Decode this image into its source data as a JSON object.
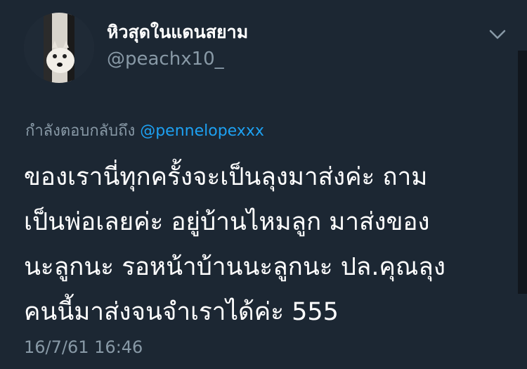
{
  "author": {
    "display_name": "หิวสุดในแดนสยาม",
    "handle": "@peachx10_"
  },
  "reply": {
    "prefix": "กำลังตอบกลับถึง",
    "mention": "@pennelopexxx"
  },
  "tweet": {
    "lines": [
      "ของเรานี่ทุกครั้งจะเป็นลุงมาส่งค่ะ ถาม",
      "เป็นพ่อเลยค่ะ อยู่บ้านไหมลูก มาส่งของ",
      "นะลูกนะ รอหน้าบ้านนะลูกนะ ปล.คุณลุง",
      "คนนี้มาส่งจนจำเราได้ค่ะ 555"
    ],
    "timestamp": "16/7/61 16:46"
  },
  "icons": {
    "menu": "chevron-down-icon",
    "avatar": "dog-avatar"
  },
  "colors": {
    "background": "#1c2733",
    "text_primary": "#ffffff",
    "text_secondary": "#8899a6",
    "link": "#1da1f2"
  }
}
